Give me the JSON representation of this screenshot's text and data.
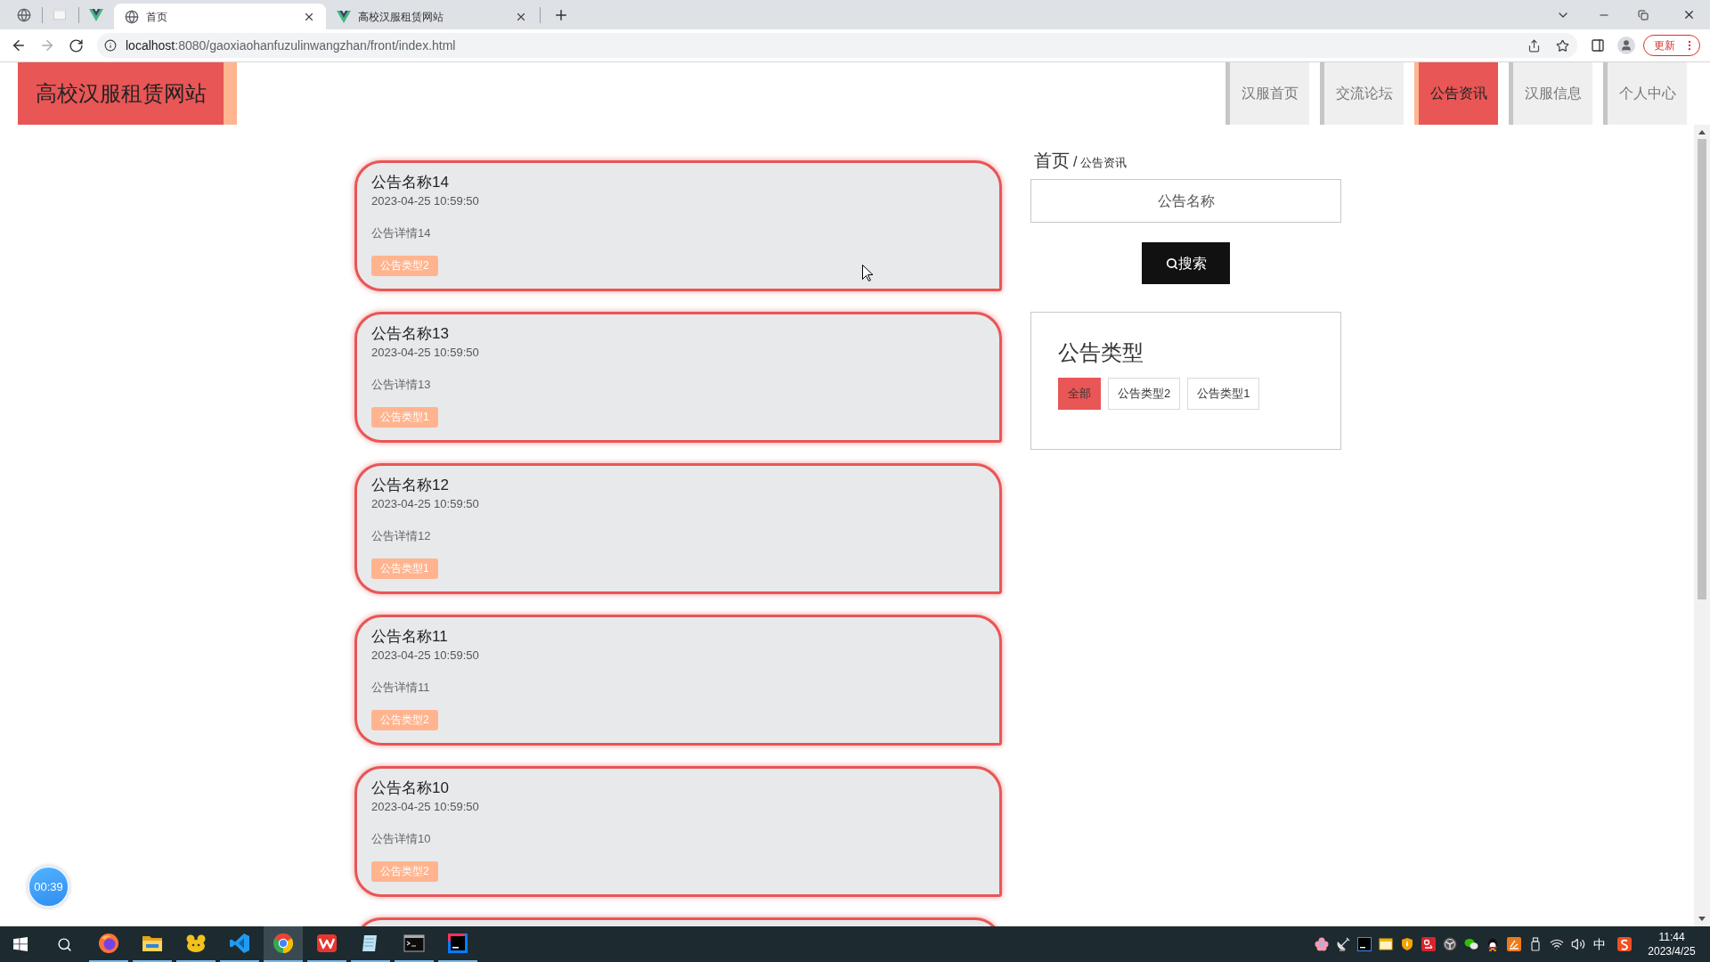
{
  "browser": {
    "tabs": [
      {
        "title": "首页",
        "selected": true
      },
      {
        "title": "高校汉服租赁网站",
        "selected": false
      }
    ],
    "url": {
      "host": "localhost",
      "path": ":8080/gaoxiaohanfuzulinwangzhan/front/index.html"
    },
    "update_button": "更新"
  },
  "header": {
    "logo": "高校汉服租赁网站",
    "nav": [
      {
        "label": "汉服首页",
        "selected": false
      },
      {
        "label": "交流论坛",
        "selected": false
      },
      {
        "label": "公告资讯",
        "selected": true
      },
      {
        "label": "汉服信息",
        "selected": false
      },
      {
        "label": "个人中心",
        "selected": false
      }
    ]
  },
  "notices": [
    {
      "title": "公告名称14",
      "time": "2023-04-25 10:59:50",
      "detail": "公告详情14",
      "tag": "公告类型2"
    },
    {
      "title": "公告名称13",
      "time": "2023-04-25 10:59:50",
      "detail": "公告详情13",
      "tag": "公告类型1"
    },
    {
      "title": "公告名称12",
      "time": "2023-04-25 10:59:50",
      "detail": "公告详情12",
      "tag": "公告类型1"
    },
    {
      "title": "公告名称11",
      "time": "2023-04-25 10:59:50",
      "detail": "公告详情11",
      "tag": "公告类型2"
    },
    {
      "title": "公告名称10",
      "time": "2023-04-25 10:59:50",
      "detail": "公告详情10",
      "tag": "公告类型2"
    }
  ],
  "sidebar": {
    "breadcrumb": {
      "home": "首页",
      "separator": "/",
      "current": "公告资讯"
    },
    "search": {
      "placeholder": "公告名称",
      "button": "搜索"
    },
    "type_filter": {
      "title": "公告类型",
      "options": [
        {
          "label": "全部",
          "selected": true
        },
        {
          "label": "公告类型2",
          "selected": false
        },
        {
          "label": "公告类型1",
          "selected": false
        }
      ]
    }
  },
  "timer": "00:39",
  "taskbar": {
    "apps": [
      {
        "kind": "firefox",
        "running": true,
        "selected": false
      },
      {
        "kind": "folder",
        "running": true,
        "selected": false
      },
      {
        "kind": "animal",
        "running": true,
        "selected": false
      },
      {
        "kind": "vscode",
        "running": true,
        "selected": false
      },
      {
        "kind": "chrome",
        "running": true,
        "selected": true
      },
      {
        "kind": "wps",
        "running": true,
        "selected": false
      },
      {
        "kind": "notepad",
        "running": true,
        "selected": false
      },
      {
        "kind": "terminal",
        "running": true,
        "selected": false
      },
      {
        "kind": "idea",
        "running": true,
        "selected": false
      }
    ],
    "ime": "中",
    "time": "11:44",
    "date": "2023/4/25"
  }
}
